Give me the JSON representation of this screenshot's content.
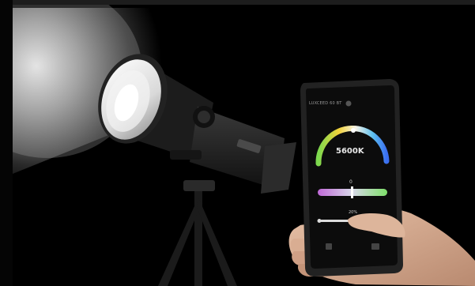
{
  "phone_screen": {
    "app_title": "LUXCEED 60 BT",
    "kelvin_readout": "5600K",
    "green_magenta_value": "0",
    "brightness_value": "20%"
  },
  "colors": {
    "background": "#000000",
    "beam_light": "#e8e8e8",
    "kelvin_arc_warm": "#f2b23a",
    "kelvin_arc_cool": "#3b8ff0",
    "gm_slider_green": "#7ee06a",
    "gm_slider_magenta": "#c06ad8"
  }
}
